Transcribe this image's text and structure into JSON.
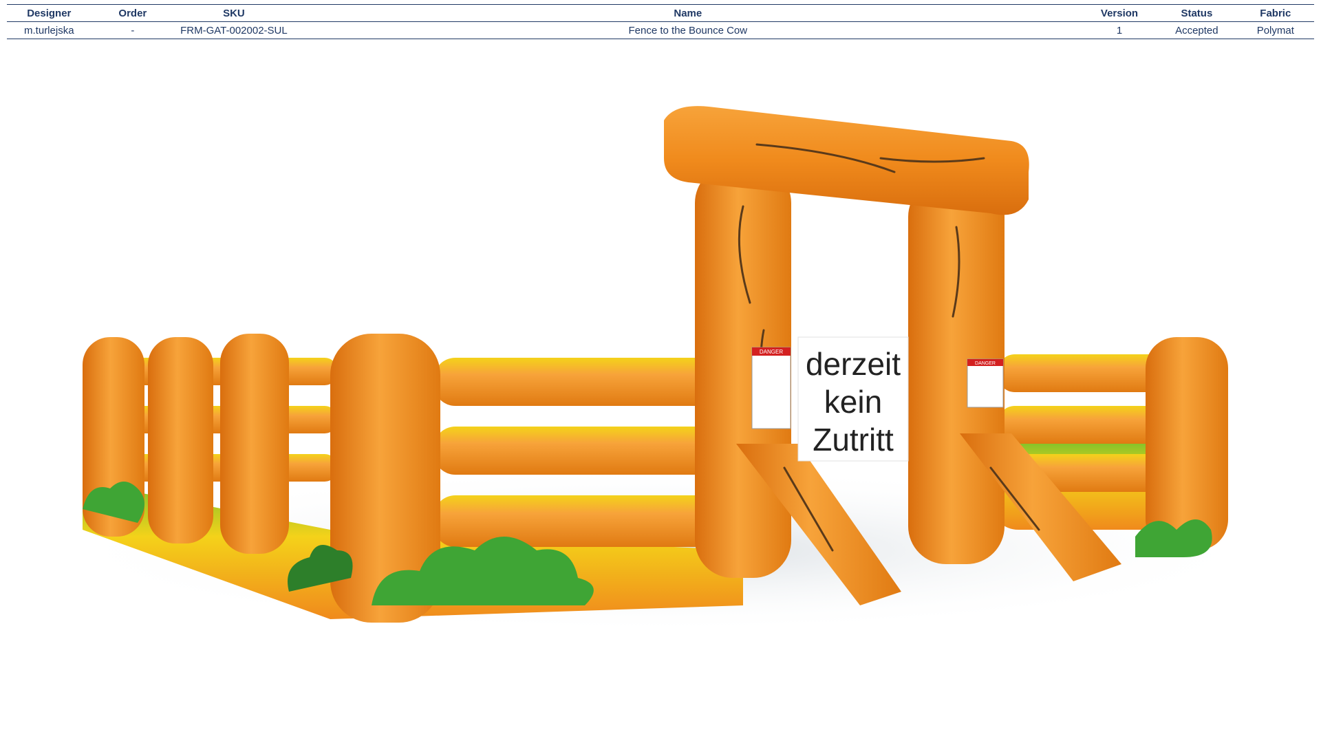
{
  "table": {
    "headers": {
      "designer": "Designer",
      "order": "Order",
      "sku": "SKU",
      "name": "Name",
      "version": "Version",
      "status": "Status",
      "fabric": "Fabric"
    },
    "row": {
      "designer": "m.turlejska",
      "order": "-",
      "sku": "FRM-GAT-002002-SUL",
      "name": "Fence to the Bounce Cow",
      "version": "1",
      "status": "Accepted",
      "fabric": "Polymat"
    }
  },
  "render": {
    "sign_lines": [
      "derzeit",
      "kein",
      "Zutritt"
    ],
    "warning_label": "DANGER",
    "colors": {
      "orange": "#f08a1c",
      "orange_light": "#f7a33a",
      "orange_dark": "#d96e0e",
      "yellow": "#f4d21a",
      "green": "#7cc22b",
      "bush": "#3fa535",
      "bush_dark": "#2d7f2a",
      "wood_lines": "#5a3a1a"
    }
  }
}
